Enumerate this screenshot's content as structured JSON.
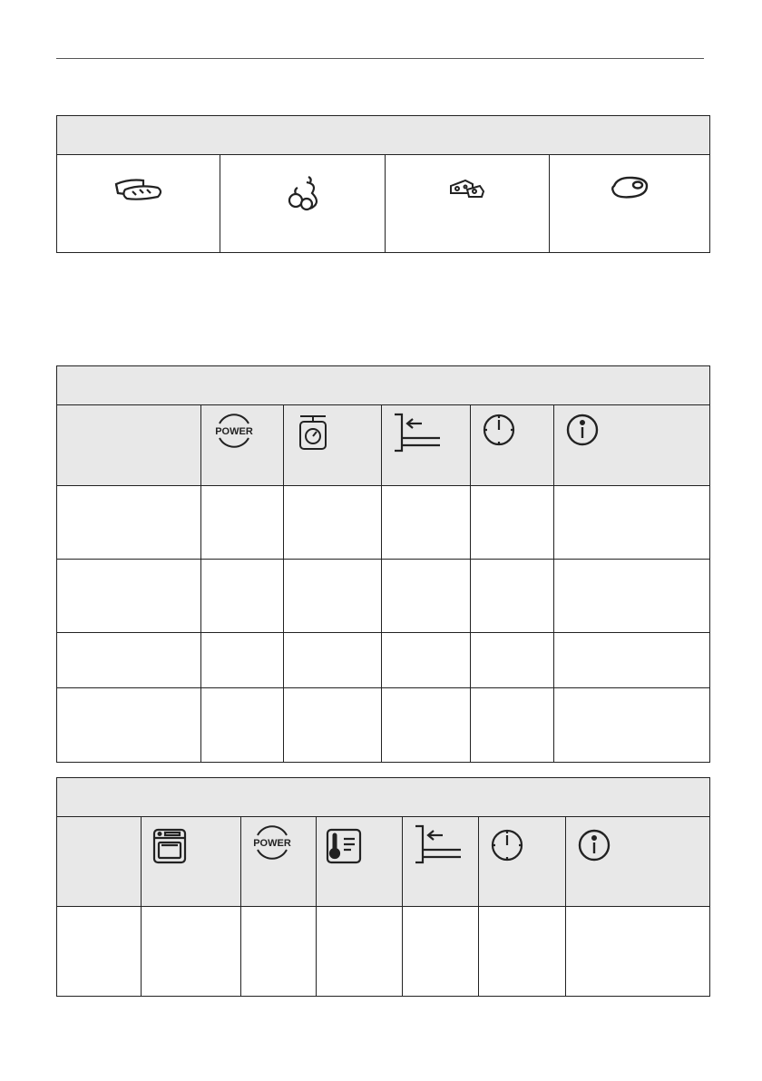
{
  "page": {
    "icons": {
      "food_categories": [
        "bread-cake-icon",
        "fruit-icon",
        "cheese-icon",
        "meat-icon"
      ],
      "table1_columns": [
        "power-icon",
        "weight-scale-icon",
        "shelf-level-icon",
        "clock-icon",
        "info-icon"
      ],
      "table2_columns": [
        "oven-icon",
        "power-icon",
        "thermometer-icon",
        "shelf-level-icon",
        "clock-icon",
        "info-icon"
      ]
    }
  }
}
